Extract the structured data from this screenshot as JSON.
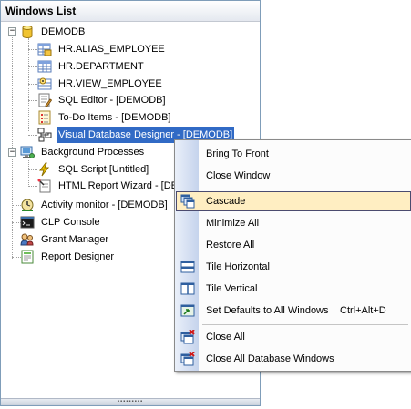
{
  "panel": {
    "title": "Windows List"
  },
  "tree": {
    "root": "DEMODB",
    "demodb_children": [
      {
        "label": "HR.ALIAS_EMPLOYEE",
        "icon": "table-alias-icon"
      },
      {
        "label": "HR.DEPARTMENT",
        "icon": "table-icon"
      },
      {
        "label": "HR.VIEW_EMPLOYEE",
        "icon": "view-icon"
      },
      {
        "label": "SQL Editor - [DEMODB]",
        "icon": "sql-editor-icon"
      },
      {
        "label": "To-Do Items - [DEMODB]",
        "icon": "todo-list-icon"
      },
      {
        "label": "Visual Database Designer - [DEMODB]",
        "icon": "database-designer-icon",
        "selected": true
      }
    ],
    "background": "Background Processes",
    "background_children": [
      {
        "label": "SQL Script [Untitled]",
        "icon": "lightning-icon"
      },
      {
        "label": "HTML Report Wizard - [DE",
        "icon": "report-wizard-icon"
      }
    ],
    "top_level": [
      {
        "label": "Activity monitor - [DEMODB]",
        "icon": "activity-monitor-icon"
      },
      {
        "label": "CLP Console",
        "icon": "console-icon"
      },
      {
        "label": "Grant Manager",
        "icon": "grant-manager-icon"
      },
      {
        "label": "Report Designer",
        "icon": "report-designer-icon"
      }
    ]
  },
  "context_menu": {
    "bring_to_front": "Bring To Front",
    "close_window": "Close Window",
    "cascade": "Cascade",
    "minimize_all": "Minimize All",
    "restore_all": "Restore All",
    "tile_horizontal": "Tile Horizontal",
    "tile_vertical": "Tile Vertical",
    "set_defaults": "Set Defaults to All Windows",
    "set_defaults_shortcut": "Ctrl+Alt+D",
    "close_all": "Close All",
    "close_all_db": "Close All Database Windows"
  },
  "colors": {
    "selection": "#316ac5",
    "menu_highlight": "#ffeec2",
    "gutter": "#c5d3ec"
  }
}
